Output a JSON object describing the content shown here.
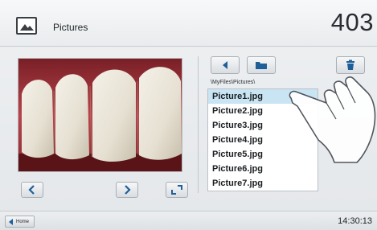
{
  "header": {
    "title": "Pictures",
    "counter": "403",
    "icon": "picture-icon"
  },
  "viewer": {
    "image_description_icon": "photo-preview",
    "prev_icon": "chevron-left-icon",
    "next_icon": "chevron-right-icon",
    "fullscreen_icon": "expand-icon"
  },
  "browser": {
    "path": "\\MyFiles\\Pictures\\",
    "back_icon": "arrow-left-icon",
    "folder_icon": "folder-icon",
    "delete_icon": "trash-icon",
    "files": [
      {
        "name": "Picture1.jpg",
        "selected": true
      },
      {
        "name": "Picture2.jpg",
        "selected": false
      },
      {
        "name": "Picture3.jpg",
        "selected": false
      },
      {
        "name": "Picture4.jpg",
        "selected": false
      },
      {
        "name": "Picture5.jpg",
        "selected": false
      },
      {
        "name": "Picture6.jpg",
        "selected": false
      },
      {
        "name": "Picture7.jpg",
        "selected": false
      }
    ]
  },
  "footer": {
    "home_label": "Home",
    "time": "14:30:13"
  },
  "colors": {
    "accent_selected": "#c9e4f2",
    "icon_blue": "#1f5f99"
  }
}
